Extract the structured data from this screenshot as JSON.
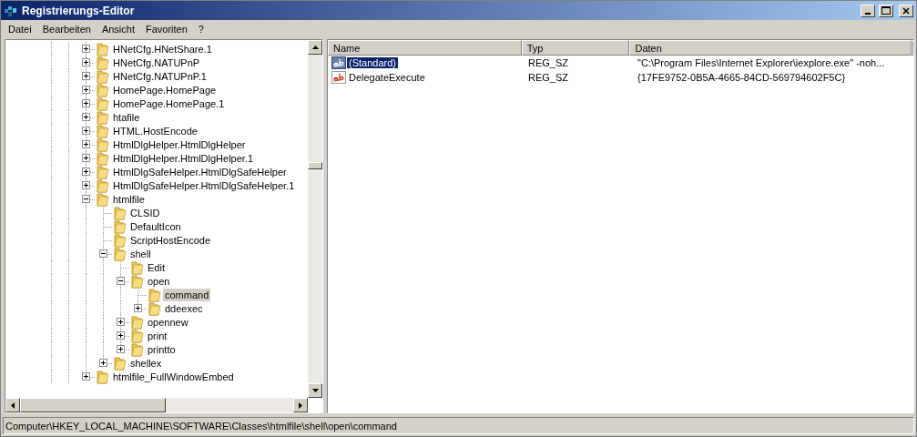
{
  "window": {
    "title": "Registrierungs-Editor"
  },
  "menu": [
    "Datei",
    "Bearbeiten",
    "Ansicht",
    "Favoriten",
    "?"
  ],
  "tree": [
    {
      "label": "HNetCfg.HNetShare.1",
      "expandable": true,
      "expanded": false,
      "selected": false
    },
    {
      "label": "HNetCfg.NATUPnP",
      "expandable": true,
      "expanded": false,
      "selected": false
    },
    {
      "label": "HNetCfg.NATUPnP.1",
      "expandable": true,
      "expanded": false,
      "selected": false
    },
    {
      "label": "HomePage.HomePage",
      "expandable": true,
      "expanded": false,
      "selected": false
    },
    {
      "label": "HomePage.HomePage.1",
      "expandable": true,
      "expanded": false,
      "selected": false
    },
    {
      "label": "htafile",
      "expandable": true,
      "expanded": false,
      "selected": false
    },
    {
      "label": "HTML.HostEncode",
      "expandable": true,
      "expanded": false,
      "selected": false
    },
    {
      "label": "HtmlDlgHelper.HtmlDlgHelper",
      "expandable": true,
      "expanded": false,
      "selected": false
    },
    {
      "label": "HtmlDlgHelper.HtmlDlgHelper.1",
      "expandable": true,
      "expanded": false,
      "selected": false
    },
    {
      "label": "HtmlDlgSafeHelper.HtmlDlgSafeHelper",
      "expandable": true,
      "expanded": false,
      "selected": false
    },
    {
      "label": "HtmlDlgSafeHelper.HtmlDlgSafeHelper.1",
      "expandable": true,
      "expanded": false,
      "selected": false
    },
    {
      "label": "htmlfile",
      "expandable": true,
      "expanded": true,
      "selected": false,
      "children": [
        {
          "label": "CLSID",
          "expandable": false,
          "selected": false
        },
        {
          "label": "DefaultIcon",
          "expandable": false,
          "selected": false
        },
        {
          "label": "ScriptHostEncode",
          "expandable": false,
          "selected": false
        },
        {
          "label": "shell",
          "expandable": true,
          "expanded": true,
          "selected": false,
          "children": [
            {
              "label": "Edit",
              "expandable": false,
              "selected": false
            },
            {
              "label": "open",
              "expandable": true,
              "expanded": true,
              "selected": false,
              "children": [
                {
                  "label": "command",
                  "expandable": false,
                  "selected": true
                },
                {
                  "label": "ddeexec",
                  "expandable": true,
                  "expanded": false,
                  "selected": false
                }
              ]
            },
            {
              "label": "opennew",
              "expandable": true,
              "expanded": false,
              "selected": false
            },
            {
              "label": "print",
              "expandable": true,
              "expanded": false,
              "selected": false
            },
            {
              "label": "printto",
              "expandable": true,
              "expanded": false,
              "selected": false
            }
          ]
        },
        {
          "label": "shellex",
          "expandable": true,
          "expanded": false,
          "selected": false
        }
      ]
    },
    {
      "label": "htmlfile_FullWindowEmbed",
      "expandable": true,
      "expanded": false,
      "selected": false
    }
  ],
  "values": {
    "columns": [
      "Name",
      "Typ",
      "Daten"
    ],
    "rows": [
      {
        "name": "(Standard)",
        "type": "REG_SZ",
        "data": "\"C:\\Program Files\\Internet Explorer\\iexplore.exe\" -noh...",
        "selected": true
      },
      {
        "name": "DelegateExecute",
        "type": "REG_SZ",
        "data": "{17FE9752-0B5A-4665-84CD-569794602F5C}",
        "selected": false
      }
    ]
  },
  "status_bar": "Computer\\HKEY_LOCAL_MACHINE\\SOFTWARE\\Classes\\htmlfile\\shell\\open\\command"
}
